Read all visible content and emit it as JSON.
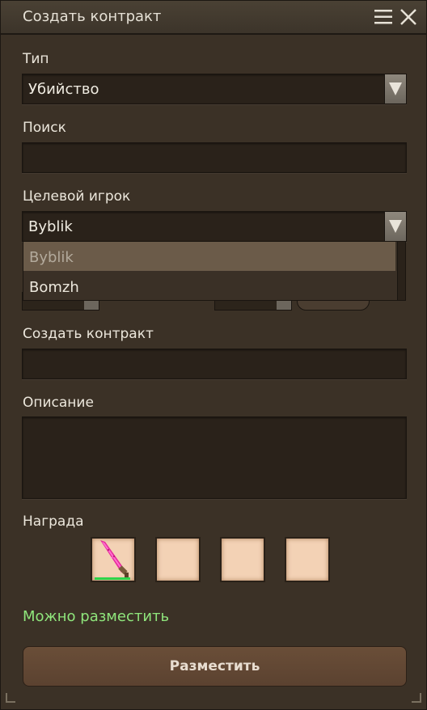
{
  "window": {
    "title": "Создать контракт"
  },
  "icons": {
    "menu": "hamburger-menu-icon",
    "close": "close-icon",
    "dropdown": "triangle-down-icon",
    "reward_item": "pink-sword-icon"
  },
  "form": {
    "type_label": "Тип",
    "type_value": "Убийство",
    "search_label": "Поиск",
    "search_value": "",
    "target_label": "Целевой игрок",
    "target_value": "Byblik",
    "target_options": [
      "Byblik",
      "Bomzh"
    ],
    "contract_label": "Создать контракт",
    "contract_value": "",
    "description_label": "Описание",
    "description_value": "",
    "reward_label": "Награда"
  },
  "status": {
    "text": "Можно разместить",
    "color": "#8fe67c"
  },
  "actions": {
    "place_label": "Разместить"
  },
  "colors": {
    "panel": "#3b3126",
    "field": "#2a221a",
    "accent_green": "#8fe67c",
    "button": "#5e4531",
    "reward_slot": "#f3d2b5"
  }
}
